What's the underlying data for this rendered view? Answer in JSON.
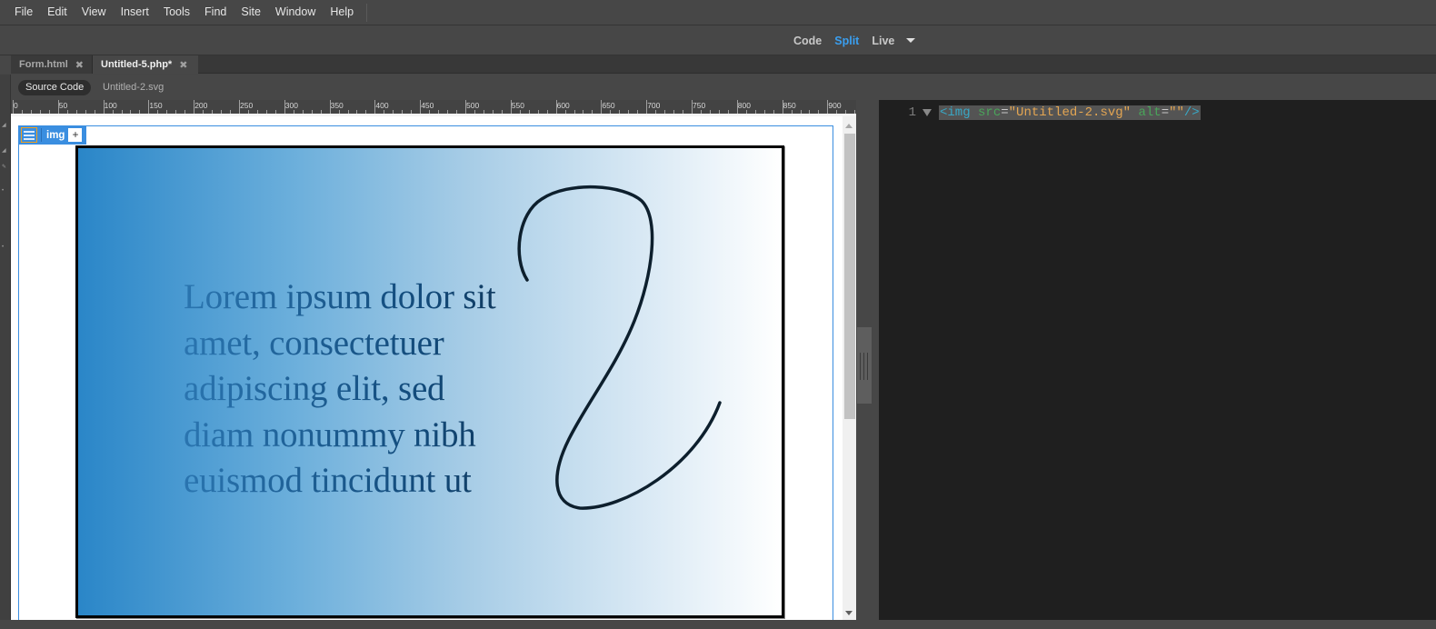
{
  "menubar": {
    "items": [
      "File",
      "Edit",
      "View",
      "Insert",
      "Tools",
      "Find",
      "Site",
      "Window",
      "Help"
    ]
  },
  "view_switcher": {
    "code": "Code",
    "split": "Split",
    "live": "Live",
    "active": "Split"
  },
  "tabs": [
    {
      "label": "Form.html",
      "active": false
    },
    {
      "label": "Untitled-5.php*",
      "active": true
    }
  ],
  "related_files": {
    "source_code": "Source Code",
    "file": "Untitled-2.svg"
  },
  "ruler": {
    "labels": [
      "0",
      "50",
      "100",
      "150",
      "200",
      "250",
      "300",
      "350",
      "400",
      "450",
      "500",
      "550",
      "600",
      "650",
      "700",
      "750",
      "800",
      "850",
      "900",
      "9"
    ]
  },
  "element_hud": {
    "tag": "img",
    "add": "+"
  },
  "svg_content": {
    "lines": [
      "Lorem ipsum dolor sit",
      "amet, consectetuer",
      "adipiscing elit, sed",
      "diam nonummy nibh",
      "euismod tincidunt ut"
    ],
    "gradient_start": "#2a86c8",
    "gradient_end": "#ffffff"
  },
  "code": {
    "line_number": "1",
    "tag_open": "<img",
    "attr1": "src",
    "eq1": "=",
    "val1": "\"Untitled-2.svg\"",
    "attr2": "alt",
    "eq2": "=",
    "val2": "\"\"",
    "tag_close": "/>"
  },
  "colors": {
    "accent": "#3a9ff0",
    "selection": "#3a8ee0"
  }
}
